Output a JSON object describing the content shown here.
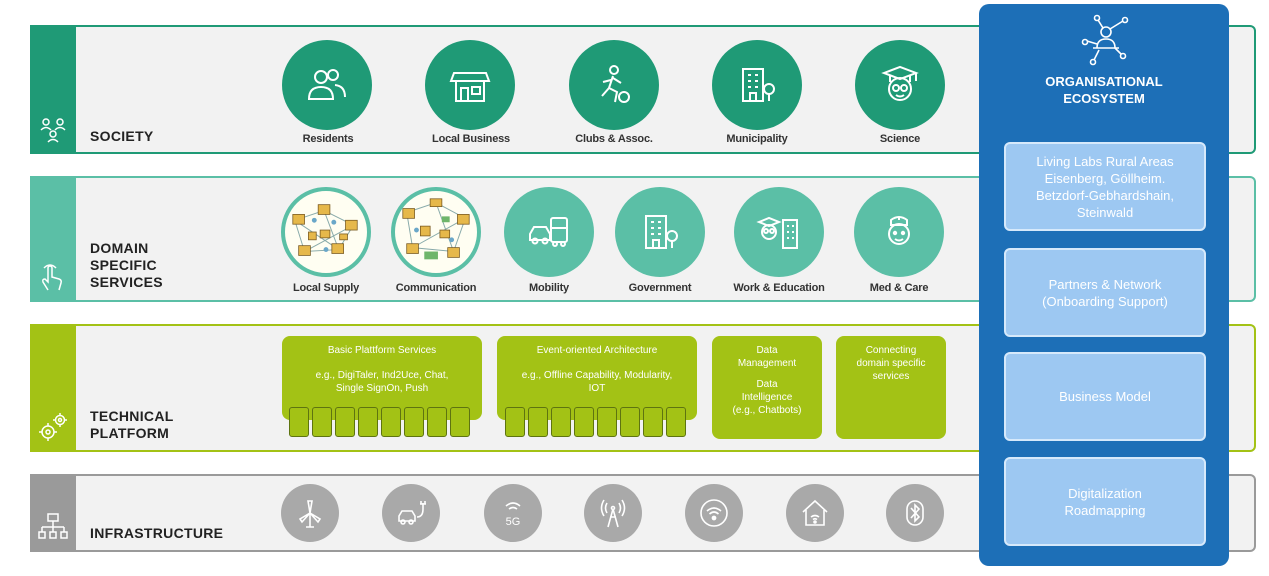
{
  "layers": {
    "society": {
      "title": "SOCIETY",
      "items": [
        "Residents",
        "Local Business",
        "Clubs & Assoc.",
        "Municipality",
        "Science"
      ]
    },
    "domain": {
      "title_line1": "DOMAIN",
      "title_line2": "SPECIFIC",
      "title_line3": "SERVICES",
      "items": [
        "Local Supply",
        "Communication",
        "Mobility",
        "Government",
        "Work & Education",
        "Med & Care"
      ]
    },
    "technical": {
      "title_line1": "TECHNICAL",
      "title_line2": "PLATFORM",
      "boxes": [
        {
          "title": "Basic Plattform Services",
          "sub_line1": "e.g., DigiTaler, Ind2Uce, Chat,",
          "sub_line2": "Single SignOn, Push"
        },
        {
          "title": "Event-oriented Architecture",
          "sub_line1": "e.g., Offline Capability, Modularity,",
          "sub_line2": "IOT"
        },
        {
          "line1": "Data",
          "line2": "Management",
          "line3": "Data",
          "line4": "Intelligence",
          "line5": "(e.g., Chatbots)"
        },
        {
          "line1": "Connecting",
          "line2": "domain specific",
          "line3": "services"
        }
      ]
    },
    "infrastructure": {
      "title": "INFRASTRUCTURE",
      "fiveg_label": "5G"
    }
  },
  "ecosystem": {
    "title_line1": "ORGANISATIONAL",
    "title_line2": "ECOSYSTEM",
    "boxes": [
      {
        "line1": "Living Labs Rural Areas",
        "line2": "Eisenberg, Göllheim.",
        "line3": "Betzdorf-Gebhardshain,",
        "line4": "Steinwald"
      },
      {
        "line1": "Partners & Network",
        "line2": "(Onboarding Support)"
      },
      {
        "line1": "Business Model"
      },
      {
        "line1": "Digitalization",
        "line2": "Roadmapping"
      }
    ]
  },
  "colors": {
    "society": "#1f9a76",
    "domain": "#5bbfa6",
    "technical": "#a3c215",
    "infrastructure": "#9a9a9a",
    "ecosystem": "#1d6fb7"
  }
}
